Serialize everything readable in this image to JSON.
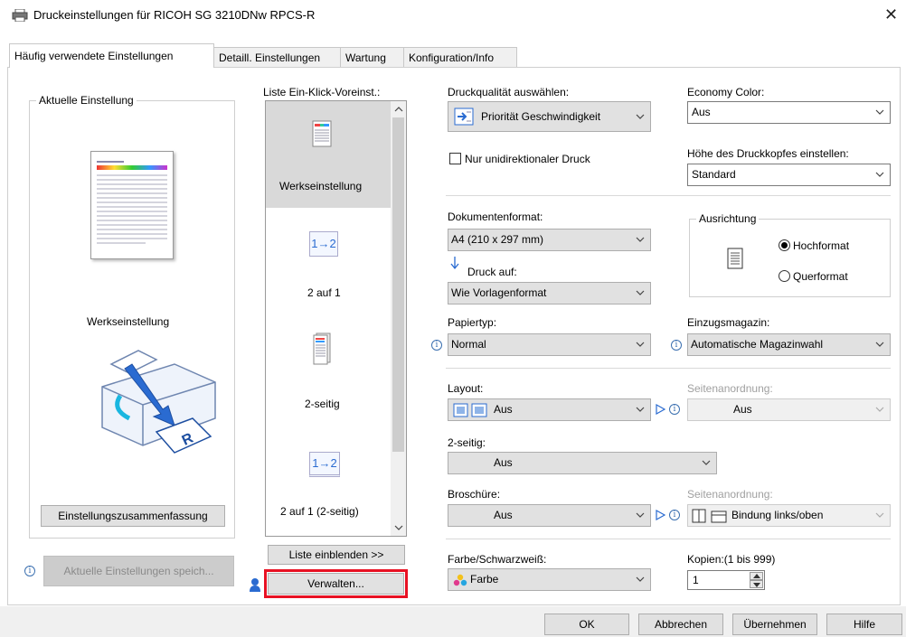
{
  "window": {
    "title": "Druckeinstellungen für RICOH SG 3210DNw RPCS-R",
    "close_glyph": "✕"
  },
  "tabs": [
    {
      "label": "Häufig verwendete Einstellungen"
    },
    {
      "label": "Detaill. Einstellungen"
    },
    {
      "label": "Wartung"
    },
    {
      "label": "Konfiguration/Info"
    }
  ],
  "current": {
    "group_title": "Aktuelle Einstellung",
    "preset_name": "Werkseinstellung",
    "summary_button": "Einstellungszusammenfassung",
    "save_button": "Aktuelle Einstellungen speich..."
  },
  "presets": {
    "label": "Liste Ein-Klick-Voreinst.:",
    "items": [
      {
        "name": "Werkseinstellung",
        "icon": "document-icon"
      },
      {
        "name": "2 auf 1",
        "icon": "2-up-icon",
        "icon_text": "1→2"
      },
      {
        "name": "2-seitig",
        "icon": "duplex-icon"
      },
      {
        "name": "2 auf 1 (2-seitig)",
        "icon": "2-up-duplex-icon",
        "icon_text": "1→2"
      }
    ],
    "show_list_button": "Liste einblenden >>",
    "manage_button": "Verwalten..."
  },
  "settings": {
    "print_quality": {
      "label": "Druckqualität auswählen:",
      "value": "Priorität Geschwindigkeit"
    },
    "economy_color": {
      "label": "Economy Color:",
      "value": "Aus"
    },
    "unidirectional": {
      "label": "Nur unidirektionaler Druck",
      "checked": false
    },
    "head_height": {
      "label": "Höhe des Druckkopfes einstellen:",
      "value": "Standard"
    },
    "doc_format": {
      "label": "Dokumentenformat:",
      "value": "A4 (210 x 297 mm)"
    },
    "print_on": {
      "label": "Druck auf:",
      "value": "Wie Vorlagenformat"
    },
    "orientation": {
      "title": "Ausrichtung",
      "portrait": "Hochformat",
      "landscape": "Querformat",
      "selected": "Hochformat"
    },
    "paper_type": {
      "label": "Papiertyp:",
      "value": "Normal"
    },
    "input_tray": {
      "label": "Einzugsmagazin:",
      "value": "Automatische Magazinwahl"
    },
    "layout": {
      "label": "Layout:",
      "value": "Aus"
    },
    "page_order_1": {
      "label": "Seitenanordnung:",
      "value": "Aus"
    },
    "duplex": {
      "label": "2-seitig:",
      "value": "Aus"
    },
    "booklet": {
      "label": "Broschüre:",
      "value": "Aus"
    },
    "page_order_2": {
      "label": "Seitenanordnung:",
      "value": "Bindung links/oben"
    },
    "color": {
      "label": "Farbe/Schwarzweiß:",
      "value": "Farbe"
    },
    "copies": {
      "label": "Kopien:(1 bis 999)",
      "value": "1"
    }
  },
  "footer": {
    "ok": "OK",
    "cancel": "Abbrechen",
    "apply": "Übernehmen",
    "help": "Hilfe"
  },
  "colors": {
    "accent": "#0078d7",
    "highlight_red": "#e81123",
    "selection": "#cce8ff"
  }
}
